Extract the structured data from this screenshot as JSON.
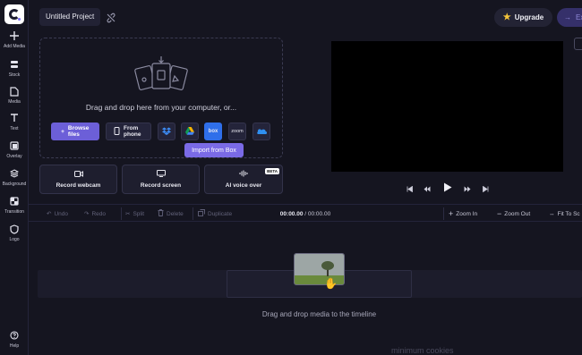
{
  "sidebar": {
    "items": [
      {
        "label": "Add Media",
        "icon": "plus-icon"
      },
      {
        "label": "Stock",
        "icon": "stock-icon"
      },
      {
        "label": "Media",
        "icon": "file-icon"
      },
      {
        "label": "Text",
        "icon": "text-icon"
      },
      {
        "label": "Overlay",
        "icon": "overlay-icon"
      },
      {
        "label": "Background",
        "icon": "layers-icon"
      },
      {
        "label": "Transition",
        "icon": "transition-icon"
      },
      {
        "label": "Logo",
        "icon": "shield-icon"
      },
      {
        "label": "Help",
        "icon": "help-icon"
      }
    ]
  },
  "header": {
    "project_title": "Untitled Project",
    "upgrade_label": "Upgrade",
    "export_label": "Ex"
  },
  "upload": {
    "drag_text": "Drag and drop here from your computer, or...",
    "browse_label": "Browse files",
    "phone_label": "From phone",
    "zoom_label": "zoom",
    "box_label": "box",
    "tooltip": "Import from Box",
    "record_webcam": "Record webcam",
    "record_screen": "Record screen",
    "ai_voice": "AI voice over",
    "beta": "BETA"
  },
  "timeline": {
    "undo": "Undo",
    "redo": "Redo",
    "split": "Split",
    "delete": "Delete",
    "duplicate": "Duplicate",
    "time_current": "00:00.00",
    "time_total": "00:00.00",
    "zoom_in": "Zoom In",
    "zoom_out": "Zoom Out",
    "fit": "Fit To Sc",
    "drop_text": "Drag and drop media to the timeline"
  },
  "footer": {
    "cookies_text": "minimum cookies"
  },
  "colors": {
    "accent": "#6c5fd8",
    "box": "#2f6fea",
    "tooltip": "#7a6ae6",
    "background": "#151520"
  }
}
